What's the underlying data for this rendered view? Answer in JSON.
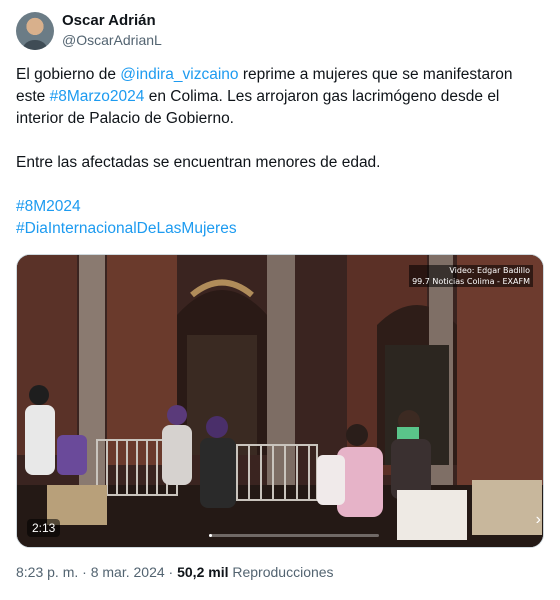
{
  "author": {
    "name": "Oscar Adrián",
    "handle": "@OscarAdrianL",
    "avatar_icon": "avatar-photo-icon"
  },
  "tweet": {
    "line1_pre": "El gobierno de ",
    "mention": "@indira_vizcaino",
    "line1_post": " reprime a mujeres que se manifestaron",
    "line2_pre": "este ",
    "hashtag_inline": "#8Marzo2024",
    "line2_post": " en Colima. Les arrojaron gas lacrimógeno desde el",
    "line3": "interior de Palacio de Gobierno.",
    "line4": "Entre las afectadas se encuentran menores de edad.",
    "hashtag1": "#8M2024",
    "hashtag2": "#DiaInternacionalDeLasMujeres"
  },
  "video": {
    "credit_line1": "Video: Edgar Badillo",
    "credit_line2": "99.7 Noticias Colima - EXAFM",
    "duration": "2:13",
    "progress": 0.0,
    "next_icon": "chevron-right-icon"
  },
  "meta": {
    "time": "8:23 p. m.",
    "separator1": " · ",
    "date": "8 mar. 2024",
    "separator2": " · ",
    "views_count": "50,2 mil",
    "views_label": " Reproducciones"
  },
  "colors": {
    "link": "#1d9bf0",
    "text": "#0f1419",
    "secondary": "#536471"
  }
}
